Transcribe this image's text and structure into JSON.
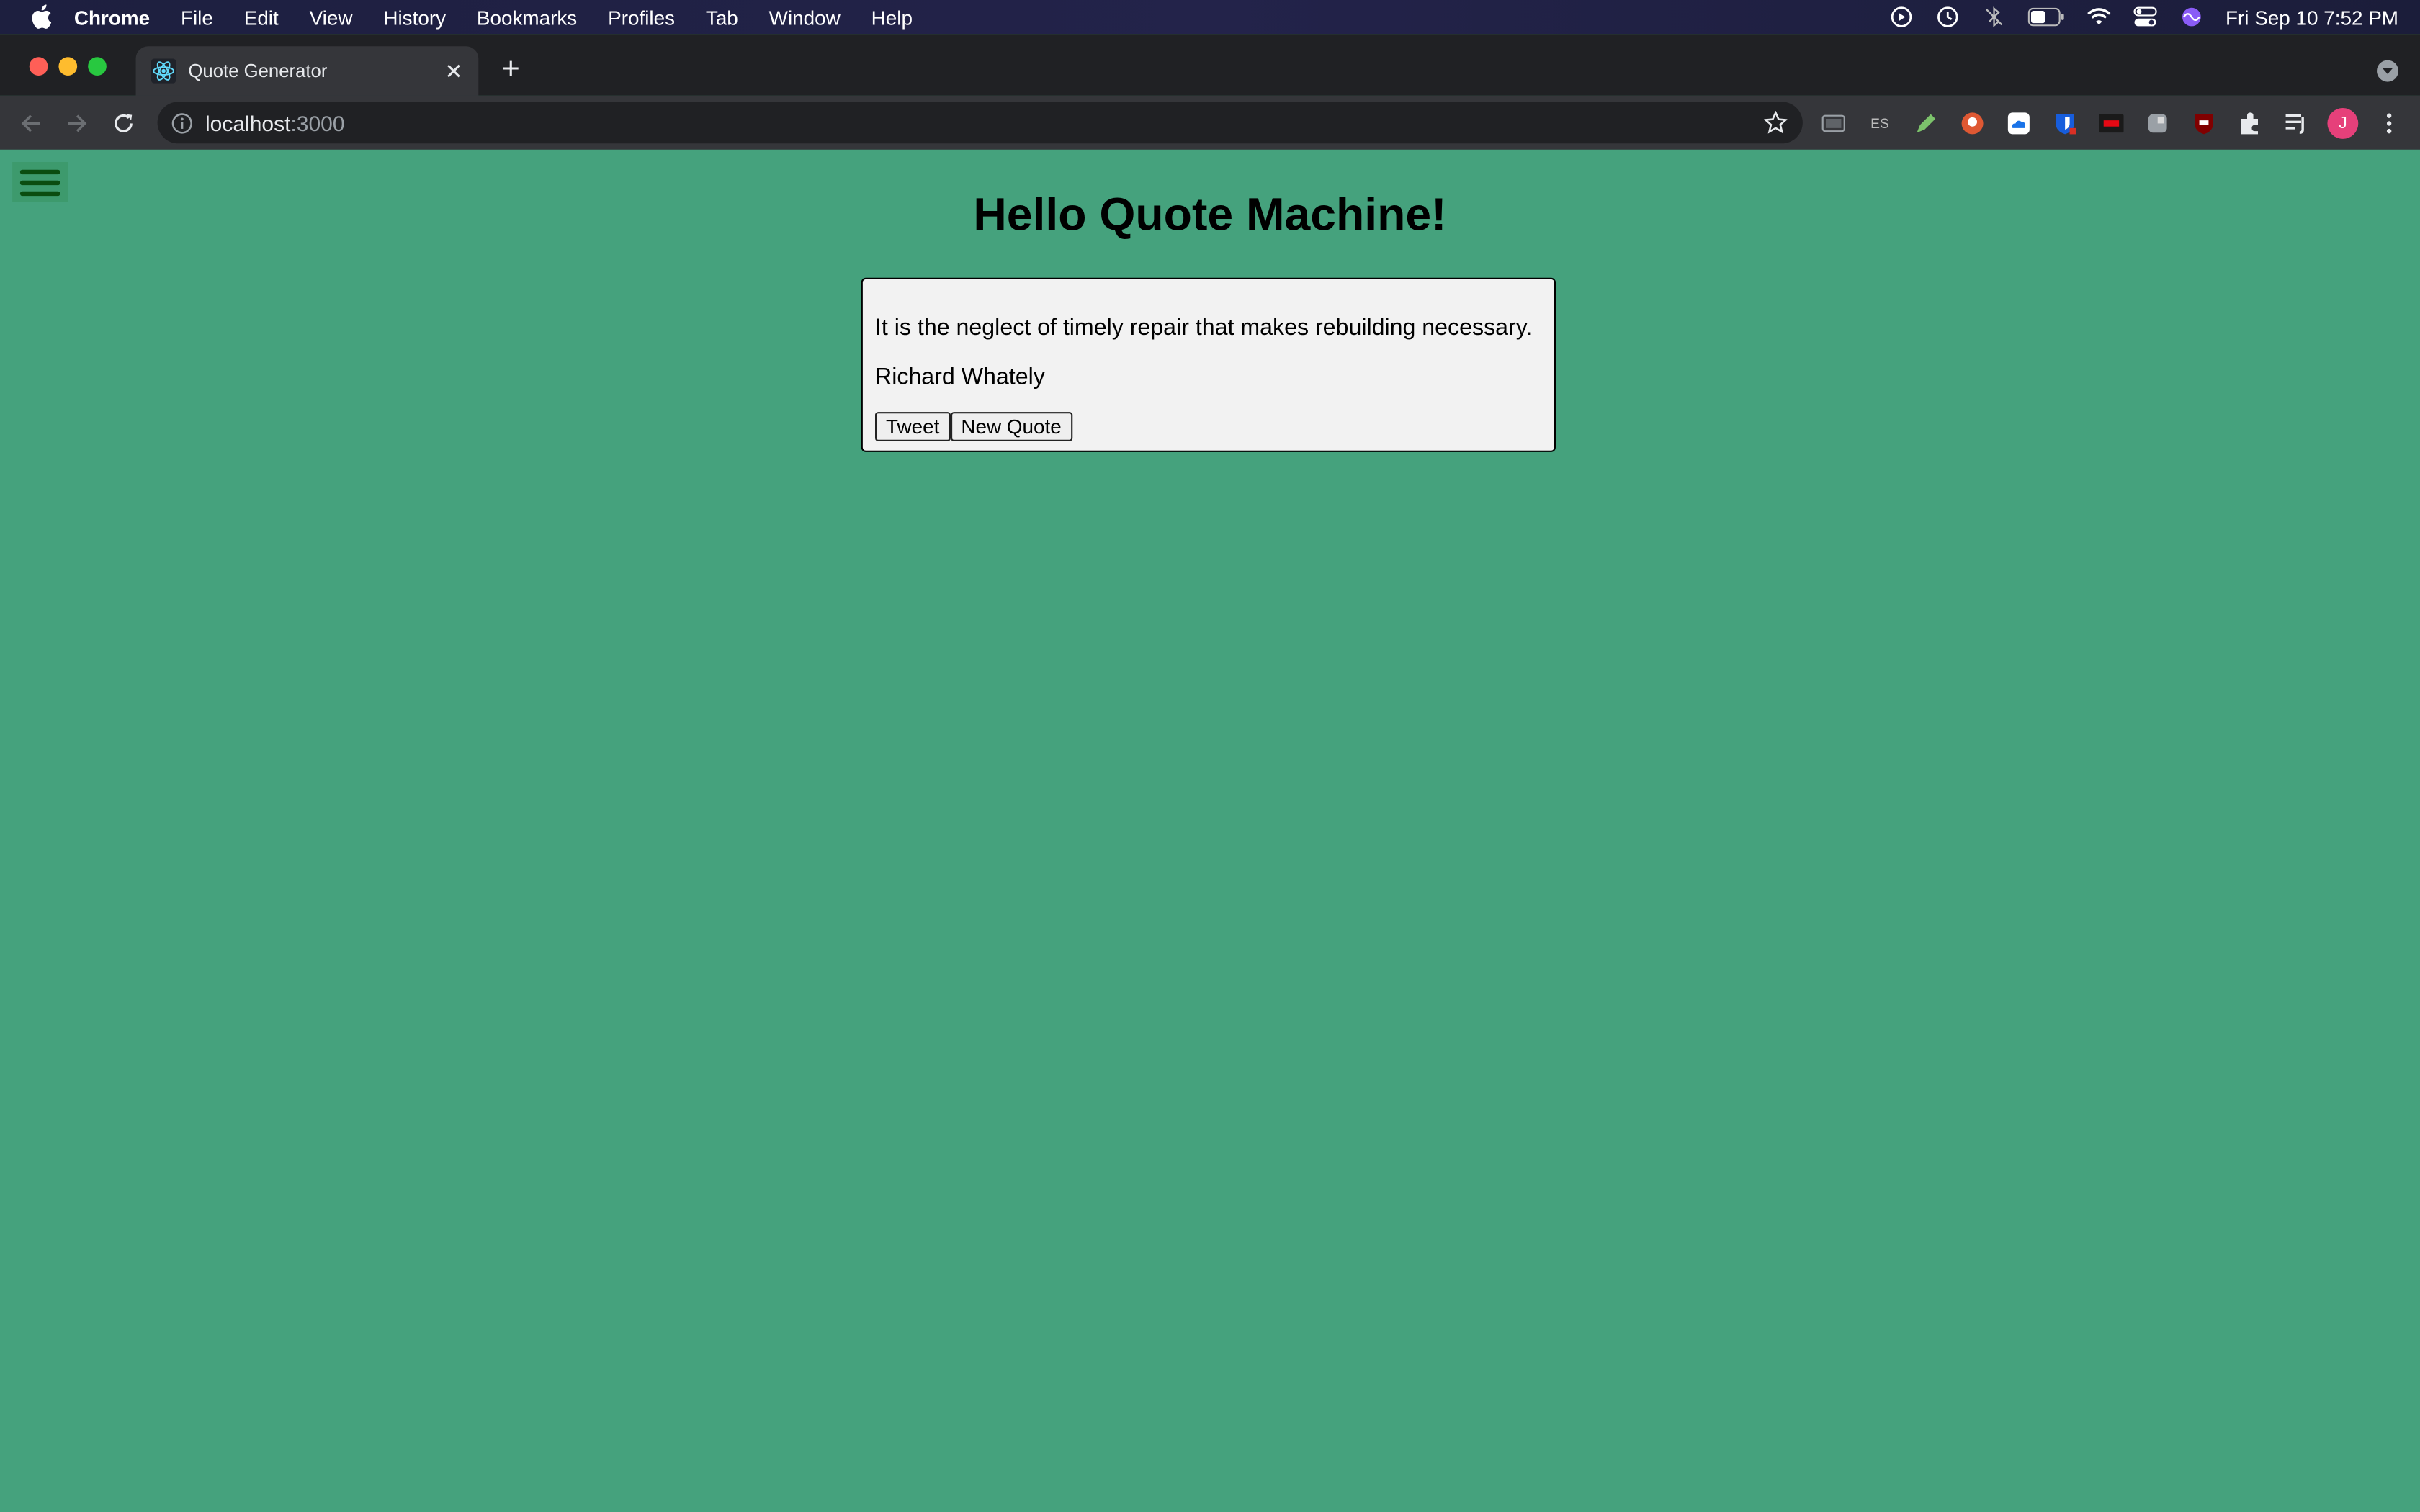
{
  "menubar": {
    "app": "Chrome",
    "items": [
      "File",
      "Edit",
      "View",
      "History",
      "Bookmarks",
      "Profiles",
      "Tab",
      "Window",
      "Help"
    ],
    "clock": "Fri Sep 10  7:52 PM"
  },
  "tabs": [
    {
      "title": "Quote Generator"
    }
  ],
  "address": {
    "host": "localhost",
    "port": ":3000"
  },
  "extensions": {
    "es_label": "ES",
    "avatar_initial": "J"
  },
  "page": {
    "heading": "Hello Quote Machine!",
    "quote": "It is the neglect of timely repair that makes rebuilding necessary.",
    "author": "Richard Whately",
    "tweet_label": "Tweet",
    "new_quote_label": "New Quote"
  },
  "colors": {
    "page_background": "#45a27d",
    "quote_box_background": "#f2f2f2",
    "hamburger_bars": "#0a4d10"
  }
}
